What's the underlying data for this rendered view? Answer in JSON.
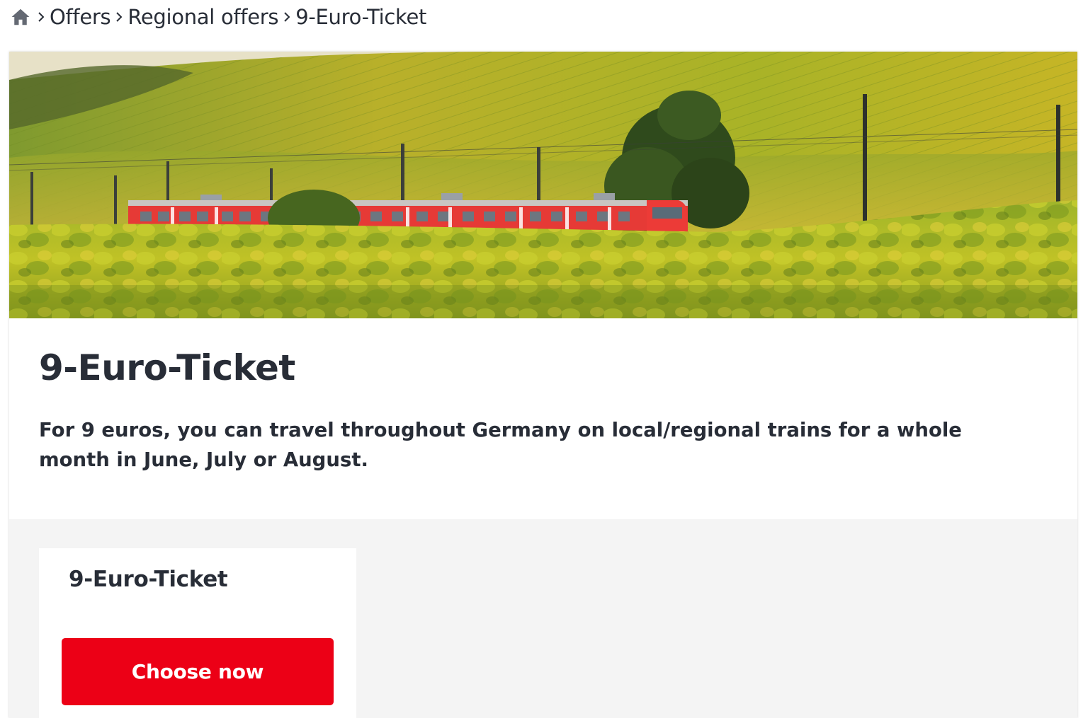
{
  "breadcrumb": {
    "home_icon": "home-icon",
    "separator_icon": "chevron-right-icon",
    "items": [
      {
        "label": "Offers"
      },
      {
        "label": "Regional offers"
      },
      {
        "label": "9-Euro-Ticket"
      }
    ]
  },
  "hero": {
    "image_alt": "Red regional train running through vineyards"
  },
  "page": {
    "title": "9-Euro-Ticket",
    "lead": "For 9 euros, you can travel throughout Germany on local/regional trains for a whole month in June, July or August."
  },
  "offer": {
    "title": "9-Euro-Ticket",
    "button_label": "Choose now"
  },
  "colors": {
    "brand_red": "#ec0016",
    "text": "#282d37",
    "offer_background": "#f4f4f4"
  }
}
